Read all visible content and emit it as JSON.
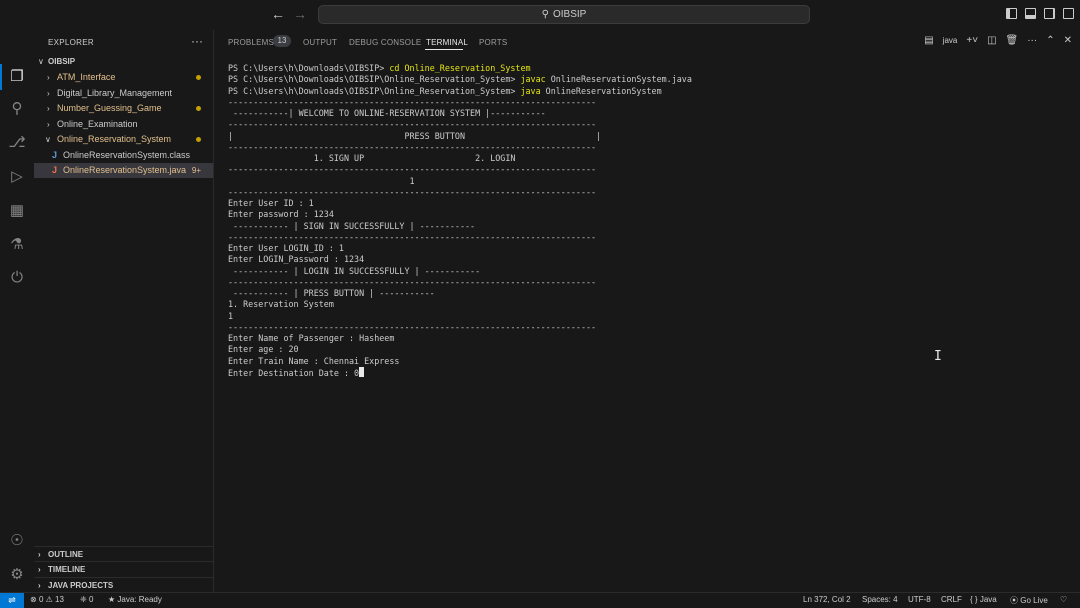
{
  "titlebar": {
    "search_text": "OIBSIP"
  },
  "explorer": {
    "header": "EXPLORER",
    "root": "OIBSIP",
    "items": [
      {
        "label": "ATM_Interface",
        "color": "#e2c08d",
        "modified": true
      },
      {
        "label": "Digital_Library_Management",
        "color": "#cccccc",
        "modified": false
      },
      {
        "label": "Number_Guessing_Game",
        "color": "#e2c08d",
        "modified": true
      },
      {
        "label": "Online_Examination",
        "color": "#cccccc",
        "modified": false
      },
      {
        "label": "Online_Reservation_System",
        "color": "#e2c08d",
        "modified": true
      }
    ],
    "files": [
      {
        "label": "OnlineReservationSystem.class",
        "color": "#cccccc"
      },
      {
        "label": "OnlineReservationSystem.java",
        "color": "#e2c08d",
        "badge": "9+"
      }
    ],
    "bottom_sections": [
      "OUTLINE",
      "TIMELINE",
      "JAVA PROJECTS"
    ]
  },
  "panel": {
    "tabs": [
      "PROBLEMS",
      "OUTPUT",
      "DEBUG CONSOLE",
      "TERMINAL",
      "PORTS"
    ],
    "problems_count": "13",
    "terminal_kind": "java"
  },
  "terminal": {
    "prompt": "PS C:\\Users\\h\\Downloads\\OIBSIP> ",
    "cmd1": "cd Online_Reservation_System",
    "prompt2": "PS C:\\Users\\h\\Downloads\\OIBSIP\\Online_Reservation_System> ",
    "cmd2a": "javac",
    "cmd2b": " OnlineReservationSystem.java",
    "cmd3a": "java",
    "cmd3b": " OnlineReservationSystem",
    "output": "-------------------------------------------------------------------------\n -----------| WELCOME TO ONLINE-RESERVATION SYSTEM |-----------\n-------------------------------------------------------------------------\n|                                  PRESS BUTTON                          |\n-------------------------------------------------------------------------\n                 1. SIGN UP                      2. LOGIN\n-------------------------------------------------------------------------\n                                    1\n-------------------------------------------------------------------------\nEnter User ID : 1\nEnter password : 1234\n ----------- | SIGN IN SUCCESSFULLY | -----------\n-------------------------------------------------------------------------\nEnter User LOGIN_ID : 1\nEnter LOGIN_Password : 1234\n ----------- | LOGIN IN SUCCESSFULLY | -----------\n-------------------------------------------------------------------------\n ----------- | PRESS BUTTON | -----------\n1. Reservation System\n1\n-------------------------------------------------------------------------\nEnter Name of Passenger : Hasheem\nEnter age : 20\nEnter Train Name : Chennai Express\nEnter Destination Date : 0"
  },
  "statusbar": {
    "errors": "0",
    "warnings": "13",
    "ports": "0",
    "java_status": "Java: Ready",
    "position": "Ln 372, Col 2",
    "spaces": "Spaces: 4",
    "encoding": "UTF-8",
    "eol": "CRLF",
    "language": "Java",
    "golive": "Go Live"
  }
}
